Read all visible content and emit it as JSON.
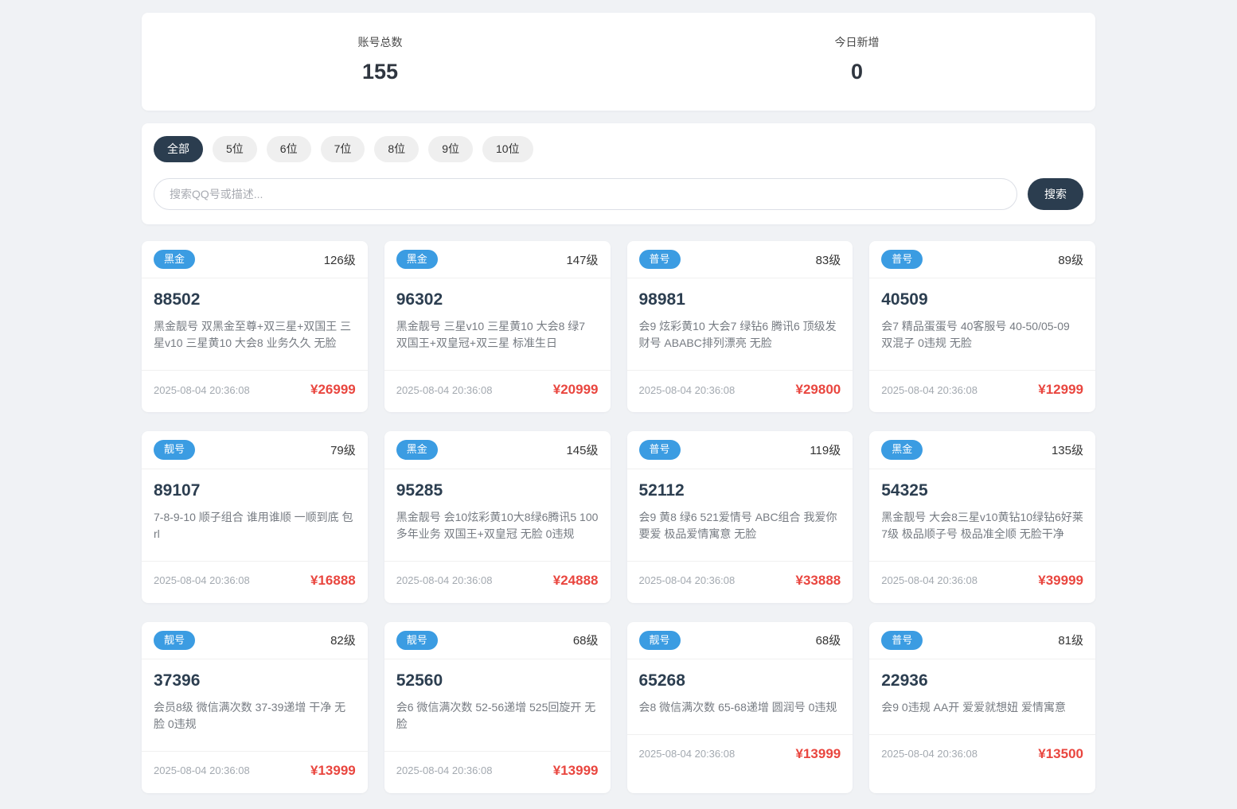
{
  "stats": {
    "total": {
      "label": "账号总数",
      "value": "155"
    },
    "today": {
      "label": "今日新增",
      "value": "0"
    }
  },
  "filters": {
    "tabs": [
      "全部",
      "5位",
      "6位",
      "7位",
      "8位",
      "9位",
      "10位"
    ],
    "active_tab": "全部",
    "search": {
      "placeholder": "搜索QQ号或描述...",
      "value": "",
      "button_label": "搜索"
    }
  },
  "cards": [
    {
      "badge": "黑金",
      "level": "126级",
      "number": "88502",
      "desc": "黑金靓号 双黑金至尊+双三星+双国王 三星v10 三星黄10 大会8 业务久久 无脸",
      "date": "2025-08-04 20:36:08",
      "price": "¥26999"
    },
    {
      "badge": "黑金",
      "level": "147级",
      "number": "96302",
      "desc": "黑金靓号 三星v10 三星黄10 大会8 绿7 双国王+双皇冠+双三星 标准生日",
      "date": "2025-08-04 20:36:08",
      "price": "¥20999"
    },
    {
      "badge": "普号",
      "level": "83级",
      "number": "98981",
      "desc": "会9 炫彩黄10 大会7 绿钻6 腾讯6 顶级发财号 ABABC排列漂亮 无脸",
      "date": "2025-08-04 20:36:08",
      "price": "¥29800"
    },
    {
      "badge": "普号",
      "level": "89级",
      "number": "40509",
      "desc": "会7 精品蛋蛋号 40客服号 40-50/05-09 双混子 0违规 无脸",
      "date": "2025-08-04 20:36:08",
      "price": "¥12999"
    },
    {
      "badge": "靓号",
      "level": "79级",
      "number": "89107",
      "desc": "7-8-9-10 顺子组合 谁用谁顺 一顺到底 包rl",
      "date": "2025-08-04 20:36:08",
      "price": "¥16888"
    },
    {
      "badge": "黑金",
      "level": "145级",
      "number": "95285",
      "desc": "黑金靓号 会10炫彩黄10大8绿6腾讯5 100多年业务 双国王+双皇冠 无脸 0违规",
      "date": "2025-08-04 20:36:08",
      "price": "¥24888"
    },
    {
      "badge": "普号",
      "level": "119级",
      "number": "52112",
      "desc": "会9 黄8 绿6 521爱情号 ABC组合 我爱你要爱 极品爱情寓意 无脸",
      "date": "2025-08-04 20:36:08",
      "price": "¥33888"
    },
    {
      "badge": "黑金",
      "level": "135级",
      "number": "54325",
      "desc": "黑金靓号 大会8三星v10黄钻10绿钻6好莱7级 极品顺子号 极品准全顺 无脸干净",
      "date": "2025-08-04 20:36:08",
      "price": "¥39999"
    },
    {
      "badge": "靓号",
      "level": "82级",
      "number": "37396",
      "desc": "会员8级 微信满次数 37-39递增 干净 无脸 0违规",
      "date": "2025-08-04 20:36:08",
      "price": "¥13999"
    },
    {
      "badge": "靓号",
      "level": "68级",
      "number": "52560",
      "desc": "会6 微信满次数 52-56递增 525回旋开 无脸",
      "date": "2025-08-04 20:36:08",
      "price": "¥13999"
    },
    {
      "badge": "靓号",
      "level": "68级",
      "number": "65268",
      "desc": "会8 微信满次数 65-68递增 圆润号 0违规",
      "date": "2025-08-04 20:36:08",
      "price": "¥13999"
    },
    {
      "badge": "普号",
      "level": "81级",
      "number": "22936",
      "desc": "会9 0违规 AA开 爱爱就想妞 爱情寓意",
      "date": "2025-08-04 20:36:08",
      "price": "¥13500"
    }
  ],
  "colors": {
    "badge_blue": "#3b9ce2",
    "dark_navy": "#2b3d4f",
    "price_red": "#e9463f",
    "page_bg": "#f0f2f5"
  }
}
